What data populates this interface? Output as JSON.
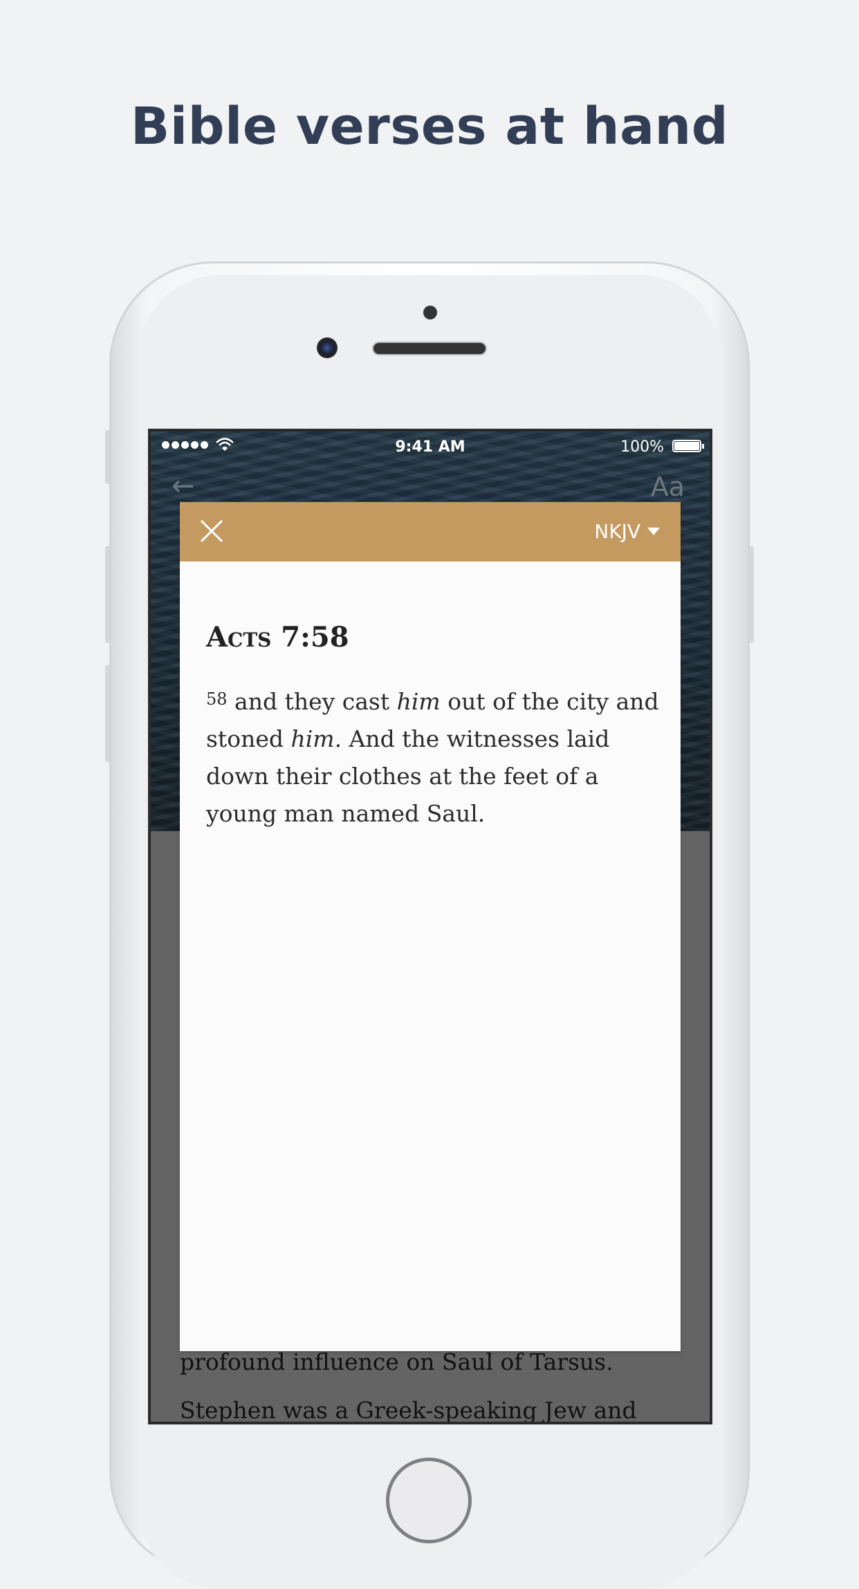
{
  "headline": "Bible verses at hand",
  "status_bar": {
    "time": "9:41 AM",
    "battery": "100%"
  },
  "nav": {
    "back_icon": "arrow-left-icon",
    "font_size_label": "Aa"
  },
  "background_text": {
    "line1": "profound influence on Saul of Tarsus.",
    "line2": "Stephen was a Greek-speaking Jew and"
  },
  "modal": {
    "close_icon": "close-icon",
    "version": "NKJV",
    "reference": "Acts 7:58",
    "verse_number": "58",
    "verse_parts": {
      "p1": " and they cast ",
      "p2": "him",
      "p3": " out of the city and stoned ",
      "p4": "him.",
      "p5": " And the witnesses laid down their clothes at the feet of a young man named Saul."
    },
    "header_color": "#c59a60"
  }
}
